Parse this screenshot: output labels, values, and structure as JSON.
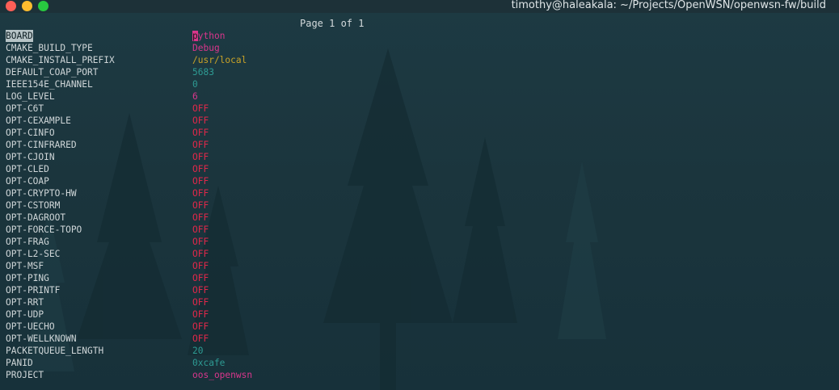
{
  "window": {
    "title": "timothy@haleakala: ~/Projects/OpenWSN/openwsn-fw/build"
  },
  "page_indicator": "Page 1 of 1",
  "colors": {
    "string": "#d9368c",
    "path": "#c9a227",
    "number": "#2e9b93",
    "off": "#e0284a",
    "selection": "#b7c4c7"
  },
  "entries": [
    {
      "key": "BOARD",
      "value": "python",
      "type": "string",
      "selected": true
    },
    {
      "key": "CMAKE_BUILD_TYPE",
      "value": "Debug",
      "type": "string"
    },
    {
      "key": "CMAKE_INSTALL_PREFIX",
      "value": "/usr/local",
      "type": "path"
    },
    {
      "key": "DEFAULT_COAP_PORT",
      "value": "5683",
      "type": "number"
    },
    {
      "key": "IEEE154E_CHANNEL",
      "value": "0",
      "type": "number"
    },
    {
      "key": "LOG_LEVEL",
      "value": "6",
      "type": "string"
    },
    {
      "key": "OPT-C6T",
      "value": "OFF",
      "type": "off"
    },
    {
      "key": "OPT-CEXAMPLE",
      "value": "OFF",
      "type": "off"
    },
    {
      "key": "OPT-CINFO",
      "value": "OFF",
      "type": "off"
    },
    {
      "key": "OPT-CINFRARED",
      "value": "OFF",
      "type": "off"
    },
    {
      "key": "OPT-CJOIN",
      "value": "OFF",
      "type": "off"
    },
    {
      "key": "OPT-CLED",
      "value": "OFF",
      "type": "off"
    },
    {
      "key": "OPT-COAP",
      "value": "OFF",
      "type": "off"
    },
    {
      "key": "OPT-CRYPTO-HW",
      "value": "OFF",
      "type": "off"
    },
    {
      "key": "OPT-CSTORM",
      "value": "OFF",
      "type": "off"
    },
    {
      "key": "OPT-DAGROOT",
      "value": "OFF",
      "type": "off"
    },
    {
      "key": "OPT-FORCE-TOPO",
      "value": "OFF",
      "type": "off"
    },
    {
      "key": "OPT-FRAG",
      "value": "OFF",
      "type": "off"
    },
    {
      "key": "OPT-L2-SEC",
      "value": "OFF",
      "type": "off"
    },
    {
      "key": "OPT-MSF",
      "value": "OFF",
      "type": "off"
    },
    {
      "key": "OPT-PING",
      "value": "OFF",
      "type": "off"
    },
    {
      "key": "OPT-PRINTF",
      "value": "OFF",
      "type": "off"
    },
    {
      "key": "OPT-RRT",
      "value": "OFF",
      "type": "off"
    },
    {
      "key": "OPT-UDP",
      "value": "OFF",
      "type": "off"
    },
    {
      "key": "OPT-UECHO",
      "value": "OFF",
      "type": "off"
    },
    {
      "key": "OPT-WELLKNOWN",
      "value": "OFF",
      "type": "off"
    },
    {
      "key": "PACKETQUEUE_LENGTH",
      "value": "20",
      "type": "number"
    },
    {
      "key": "PANID",
      "value": "0xcafe",
      "type": "number"
    },
    {
      "key": "PROJECT",
      "value": "oos_openwsn",
      "type": "string"
    }
  ]
}
